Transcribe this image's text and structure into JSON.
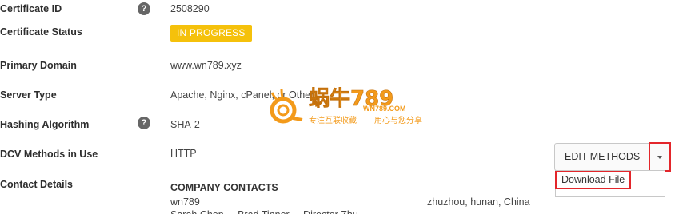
{
  "fields": {
    "certificate_id_label": "Certificate ID",
    "certificate_id_value": "2508290",
    "certificate_status_label": "Certificate Status",
    "certificate_status_value": "IN PROGRESS",
    "primary_domain_label": "Primary Domain",
    "primary_domain_value": "www.wn789.xyz",
    "server_type_label": "Server Type",
    "server_type_value": "Apache, Nginx, cPanel, or Other",
    "hashing_algorithm_label": "Hashing Algorithm",
    "hashing_algorithm_value": "SHA-2",
    "dcv_methods_label": "DCV Methods in Use",
    "dcv_methods_value": "HTTP",
    "contact_details_label": "Contact Details"
  },
  "help_icon_glyph": "?",
  "actions": {
    "edit_methods_label": "EDIT METHODS",
    "dropdown_items": [
      "Download File"
    ]
  },
  "contacts": {
    "header": "COMPANY CONTACTS",
    "name": "wn789",
    "location": "zhuzhou, hunan, China",
    "truncated_line": "Sarah Chen ...  Brad Tinner  ...  Director  Zhu..."
  },
  "watermark": {
    "brand": "蜗牛789",
    "domain": "WN789.COM",
    "slogan_left": "专注互联收藏",
    "slogan_right": "用心与您分享"
  },
  "colors": {
    "status_badge": "#f5c10b",
    "highlight_box": "#e3262b",
    "logo_orange": "#f39a1a"
  }
}
